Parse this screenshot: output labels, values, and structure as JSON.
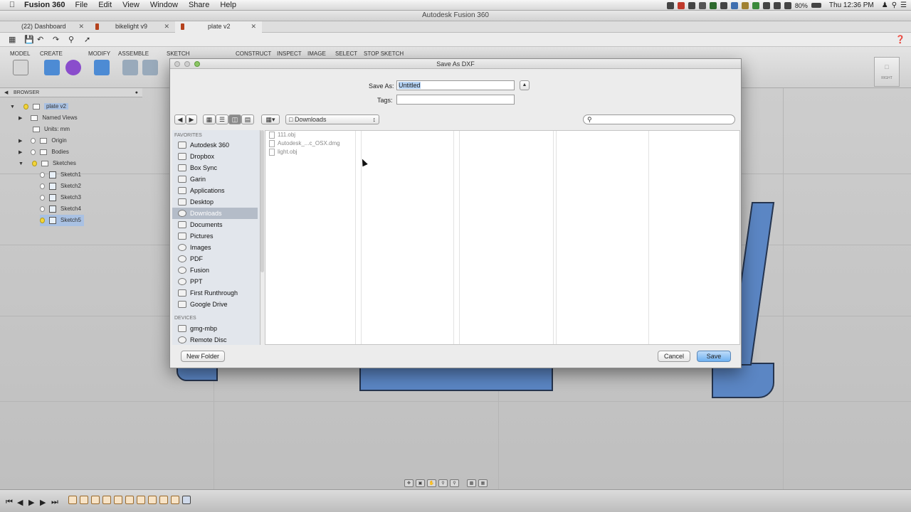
{
  "menubar": {
    "app": "Fusion 360",
    "items": [
      "File",
      "Edit",
      "View",
      "Window",
      "Share",
      "Help"
    ],
    "battery": "80%",
    "clock": "Thu 12:36 PM"
  },
  "window": {
    "title": "Autodesk Fusion 360"
  },
  "tabs": [
    {
      "label": "(22) Dashboard"
    },
    {
      "label": "bikelight v9"
    },
    {
      "label": "plate v2"
    }
  ],
  "ribbon": {
    "labels": [
      "MODEL",
      "CREATE",
      "MODIFY",
      "ASSEMBLE",
      "SKETCH",
      "CONSTRUCT",
      "INSPECT",
      "IMAGE",
      "SELECT",
      "STOP SKETCH"
    ]
  },
  "browser_panel": {
    "header": "BROWSER",
    "root": "plate v2",
    "items": [
      "Named Views",
      "Units: mm",
      "Origin",
      "Bodies",
      "Sketches"
    ],
    "sketches": [
      "Sketch1",
      "Sketch2",
      "Sketch3",
      "Sketch4",
      "Sketch5"
    ]
  },
  "viewcube": {
    "label": "RIGHT"
  },
  "dialog": {
    "title": "Save As DXF",
    "save_as_label": "Save As:",
    "save_as_value": "Untitled",
    "tags_label": "Tags:",
    "location": "Downloads",
    "favorites_header": "FAVORITES",
    "favorites": [
      "Autodesk 360",
      "Dropbox",
      "Box Sync",
      "Garin",
      "Applications",
      "Desktop",
      "Downloads",
      "Documents",
      "Pictures",
      "Images",
      "PDF",
      "Fusion",
      "PPT",
      "First Runthrough",
      "Google Drive"
    ],
    "devices_header": "DEVICES",
    "devices": [
      "gmg-mbp",
      "Remote Disc"
    ],
    "files": [
      "111.obj",
      "Autodesk_...c_OSX.dmg",
      "light.obj"
    ],
    "new_folder": "New Folder",
    "cancel": "Cancel",
    "save": "Save"
  }
}
